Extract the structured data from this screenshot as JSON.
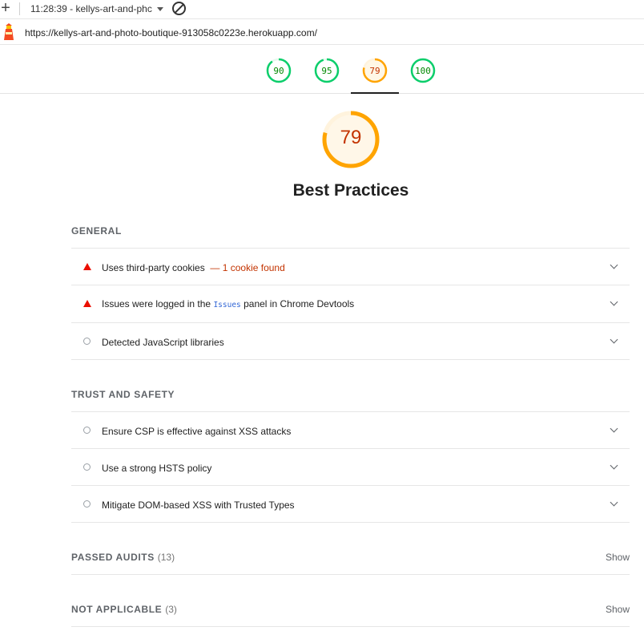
{
  "toolbar": {
    "session": "11:28:39 - kellys-art-and-phc",
    "url": "https://kellys-art-and-photo-boutique-913058c0223e.herokuapp.com/"
  },
  "gauges": [
    {
      "score": 90,
      "color": "#0cce6b",
      "active": false
    },
    {
      "score": 95,
      "color": "#0cce6b",
      "active": false
    },
    {
      "score": 79,
      "color": "#ffa400",
      "active": true
    },
    {
      "score": 100,
      "color": "#0cce6b",
      "active": false
    }
  ],
  "category": {
    "score": 79,
    "title": "Best Practices",
    "color": "#ffa400"
  },
  "sections": {
    "general": {
      "heading": "GENERAL",
      "audits": [
        {
          "title": "Uses third-party cookies",
          "warning": "— 1 cookie found",
          "status": "fail"
        },
        {
          "title_pre": "Issues were logged in the",
          "code": "Issues",
          "title_post": "panel in Chrome Devtools",
          "status": "fail"
        },
        {
          "title": "Detected JavaScript libraries",
          "status": "informative"
        }
      ]
    },
    "trust": {
      "heading": "TRUST AND SAFETY",
      "audits": [
        {
          "title": "Ensure CSP is effective against XSS attacks",
          "status": "informative"
        },
        {
          "title": "Use a strong HSTS policy",
          "status": "informative"
        },
        {
          "title": "Mitigate DOM-based XSS with Trusted Types",
          "status": "informative"
        }
      ]
    },
    "passed": {
      "heading": "PASSED AUDITS",
      "count": "(13)",
      "show": "Show"
    },
    "not_applicable": {
      "heading": "NOT APPLICABLE",
      "count": "(3)",
      "show": "Show"
    }
  },
  "colors": {
    "pass": "#0cce6b",
    "average": "#ffa400",
    "fail": "#eb0f00"
  },
  "icons": [
    "plus-icon",
    "caret-down-icon",
    "block-icon",
    "lighthouse-icon",
    "warning-triangle-icon",
    "info-circle-icon",
    "chevron-down-icon"
  ]
}
